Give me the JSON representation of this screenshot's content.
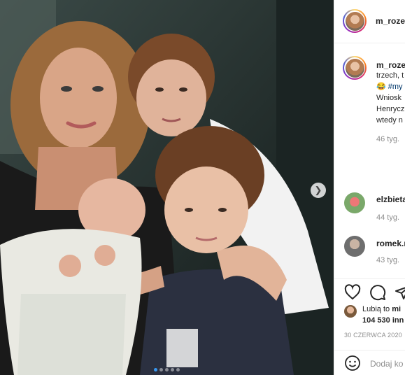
{
  "post": {
    "username": "m_rozer",
    "carousel": {
      "dot_count": 5,
      "active_index": 0
    }
  },
  "caption": {
    "username": "m_roze",
    "lines": [
      "trzech, t",
      "Wniosk",
      "Henrycz",
      "wtedy n"
    ],
    "emoji": "😂",
    "hashtag": "#my",
    "time": "46 tyg."
  },
  "comments": [
    {
      "username": "elzbieta",
      "time": "44 tyg."
    },
    {
      "username": "romek.r",
      "time": "43 tyg."
    }
  ],
  "likes": {
    "prefix": "Lubią to",
    "name": "mi",
    "count": "104 530 inn"
  },
  "date": "30 CZERWCA 2020",
  "add_comment_placeholder": "Dodaj ko",
  "icons": {
    "like": "heart-icon",
    "comment": "comment-icon",
    "share": "send-icon",
    "emoji": "smiley-icon",
    "next": "chevron-right-icon"
  }
}
